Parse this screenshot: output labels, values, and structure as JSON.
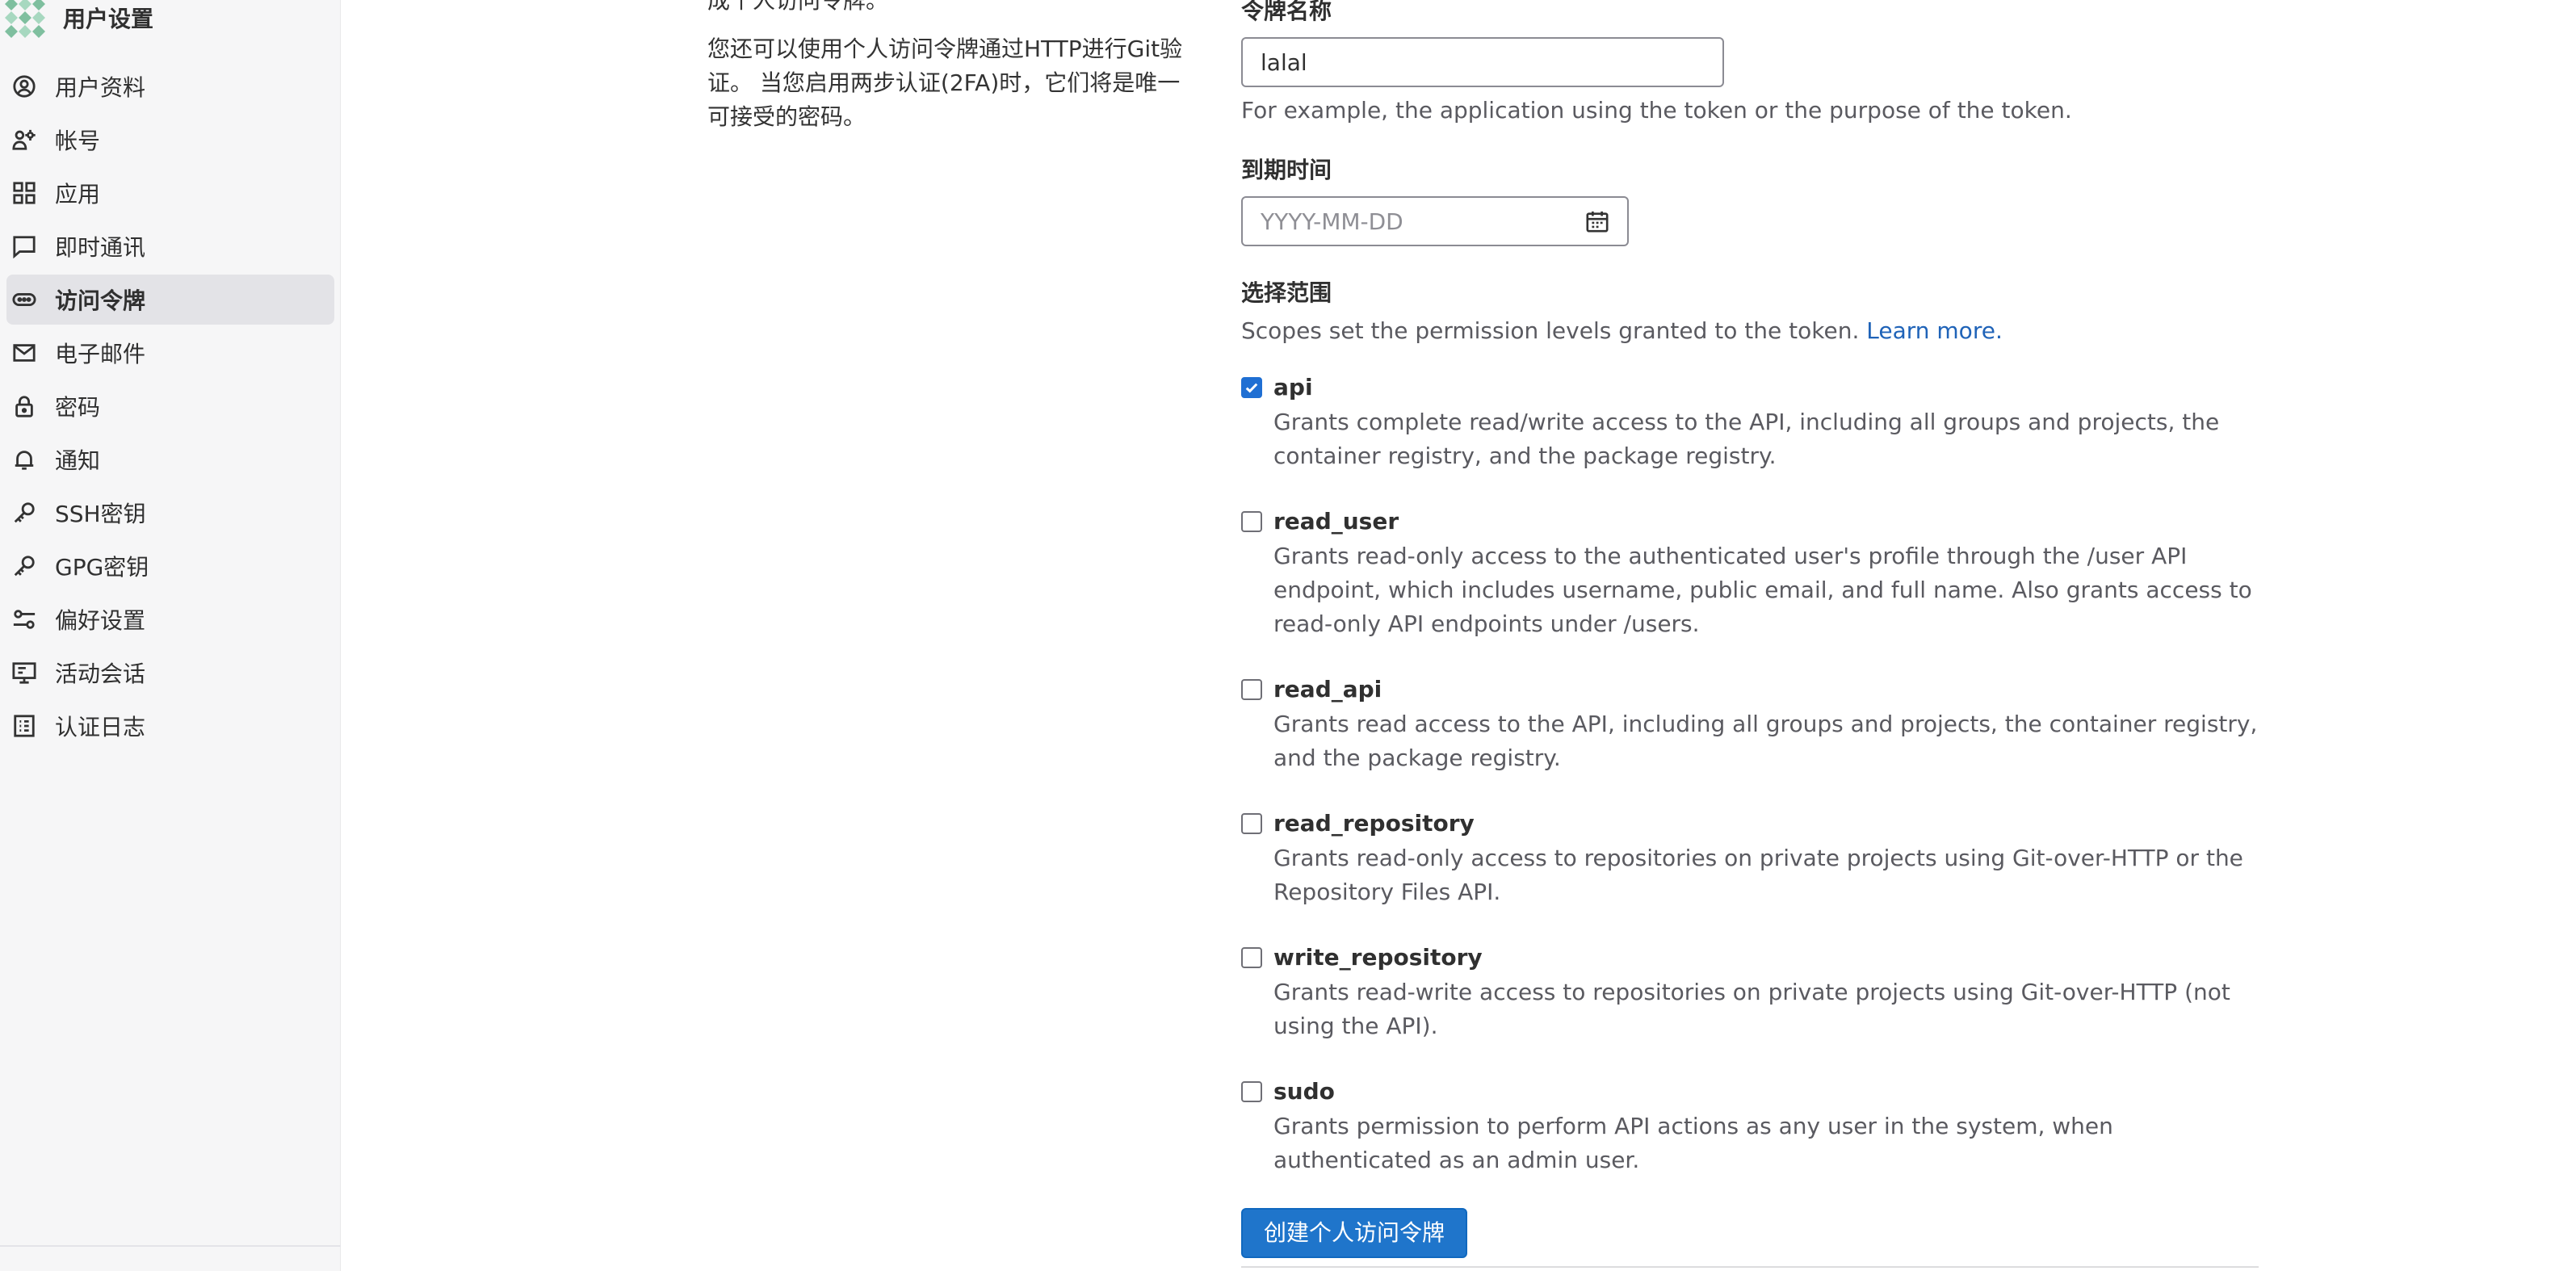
{
  "sidebar": {
    "title": "用户设置",
    "items": [
      {
        "label": "用户资料",
        "icon": "profile-icon"
      },
      {
        "label": "帐号",
        "icon": "account-icon"
      },
      {
        "label": "应用",
        "icon": "applications-icon"
      },
      {
        "label": "即时通讯",
        "icon": "chat-icon"
      },
      {
        "label": "访问令牌",
        "icon": "token-icon",
        "active": true
      },
      {
        "label": "电子邮件",
        "icon": "mail-icon"
      },
      {
        "label": "密码",
        "icon": "lock-icon"
      },
      {
        "label": "通知",
        "icon": "bell-icon"
      },
      {
        "label": "SSH密钥",
        "icon": "key-icon"
      },
      {
        "label": "GPG密钥",
        "icon": "key-icon"
      },
      {
        "label": "偏好设置",
        "icon": "preferences-icon"
      },
      {
        "label": "活动会话",
        "icon": "monitor-icon"
      },
      {
        "label": "认证日志",
        "icon": "log-icon"
      }
    ]
  },
  "description": {
    "partial_line": "成个人访问令牌。",
    "paragraph": "您还可以使用个人访问令牌通过HTTP进行Git验证。 当您启用两步认证(2FA)时，它们将是唯一可接受的密码。"
  },
  "form": {
    "name_label": "令牌名称",
    "name_value": "lalal",
    "name_help": "For example, the application using the token or the purpose of the token.",
    "expiry_label": "到期时间",
    "expiry_placeholder": "YYYY-MM-DD",
    "scopes_label": "选择范围",
    "scopes_help": "Scopes set the permission levels granted to the token.",
    "scopes_link": "Learn more.",
    "scopes": [
      {
        "name": "api",
        "checked": true,
        "desc": "Grants complete read/write access to the API, including all groups and projects, the container registry, and the package registry."
      },
      {
        "name": "read_user",
        "checked": false,
        "desc": "Grants read-only access to the authenticated user's profile through the /user API endpoint, which includes username, public email, and full name. Also grants access to read-only API endpoints under /users."
      },
      {
        "name": "read_api",
        "checked": false,
        "desc": "Grants read access to the API, including all groups and projects, the container registry, and the package registry."
      },
      {
        "name": "read_repository",
        "checked": false,
        "desc": "Grants read-only access to repositories on private projects using Git-over-HTTP or the Repository Files API."
      },
      {
        "name": "write_repository",
        "checked": false,
        "desc": "Grants read-write access to repositories on private projects using Git-over-HTTP (not using the API)."
      },
      {
        "name": "sudo",
        "checked": false,
        "desc": "Grants permission to perform API actions as any user in the system, when authenticated as an admin user."
      }
    ],
    "submit_label": "创建个人访问令牌"
  },
  "colors": {
    "accent": "#1f75cb",
    "link": "#1f63b8",
    "sidebar_bg": "#f6f6f7"
  }
}
